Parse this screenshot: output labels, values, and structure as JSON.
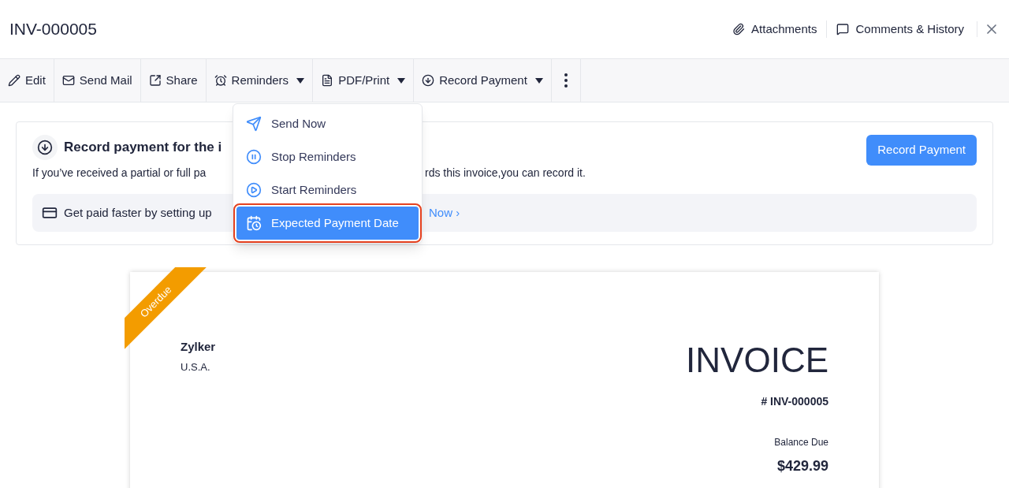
{
  "header": {
    "title": "INV-000005",
    "links": [
      {
        "label": "Attachments",
        "kind": "clip"
      },
      {
        "label": "Comments & History",
        "kind": "comment"
      }
    ]
  },
  "toolbar": [
    {
      "label": "Edit",
      "kind": "pencil",
      "dropdown": false
    },
    {
      "label": "Send Mail",
      "kind": "mail",
      "dropdown": false
    },
    {
      "label": "Share",
      "kind": "share",
      "dropdown": false
    },
    {
      "label": "Reminders",
      "kind": "alarm",
      "dropdown": true
    },
    {
      "label": "PDF/Print",
      "kind": "pdf",
      "dropdown": true
    },
    {
      "label": "Record Payment",
      "kind": "download",
      "dropdown": true
    }
  ],
  "menu": [
    {
      "label": "Send Now",
      "kind": "send",
      "selected": false
    },
    {
      "label": "Stop Reminders",
      "kind": "pause",
      "selected": false
    },
    {
      "label": "Start Reminders",
      "kind": "play",
      "selected": false
    },
    {
      "label": "Expected Payment Date",
      "kind": "calendar",
      "selected": true
    }
  ],
  "banner": {
    "title": "Record payment for the i",
    "text_left": "If you’ve received a partial or full pa",
    "text_right": "rds this invoice,you can record it.",
    "button": "Record Payment",
    "tip": "Get paid faster by setting up",
    "tip_link": "Now ›"
  },
  "invoice": {
    "ribbon": "Overdue",
    "company": "Zylker",
    "country": "U.S.A.",
    "heading": "INVOICE",
    "number": "# INV-000005",
    "balance_label": "Balance Due",
    "balance": "$429.99"
  }
}
